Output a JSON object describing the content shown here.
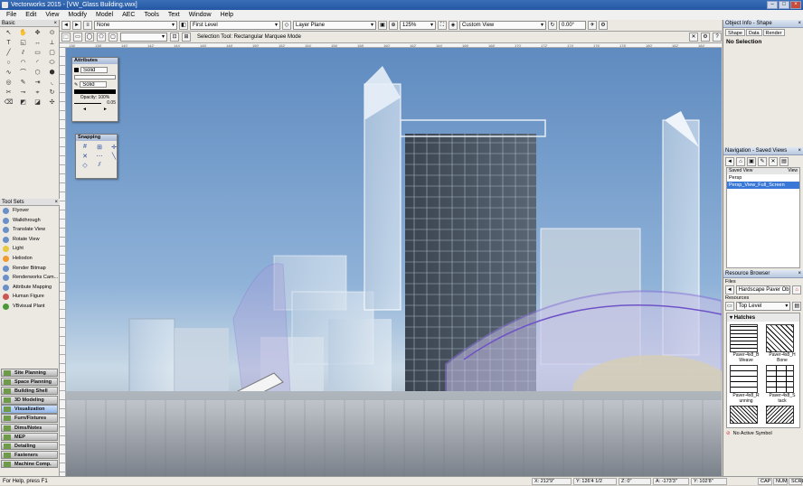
{
  "window": {
    "title": "Vectorworks 2015 - [VW_Glass Building.vwx]"
  },
  "menu": [
    "File",
    "Edit",
    "View",
    "Modify",
    "Model",
    "AEC",
    "Tools",
    "Text",
    "Window",
    "Help"
  ],
  "toolbar": {
    "class_value": "None",
    "layer_value": "First Level",
    "plane_value": "Layer Plane",
    "zoom_value": "125%",
    "view_value": "Custom View",
    "angle_value": "0.00°",
    "mode_text": "Selection Tool: Rectangular Marquee Mode"
  },
  "basic_palette": {
    "title": "Basic"
  },
  "attributes_palette": {
    "title": "Attributes",
    "fill_style": "Solid",
    "pen_style": "Solid",
    "opacity_label": "Opacity: 100%",
    "pen_weight": "0.05"
  },
  "snapping_palette": {
    "title": "Snapping"
  },
  "tool_sets": {
    "title": "Tool Sets",
    "items": [
      "Flyover",
      "Walkthrough",
      "Translate View",
      "Rotate View",
      "Light",
      "Heliodon",
      "Render Bitmap",
      "Renderworks Cam...",
      "Attribute Mapping",
      "Human Figure",
      "VBvisual Plant"
    ]
  },
  "categories": [
    "Site Planning",
    "Space Planning",
    "Building Shell",
    "3D Modeling",
    "Visualization",
    "Furn/Fixtures",
    "Dims/Notes",
    "MEP",
    "Detailing",
    "Fasteners",
    "Machine Comp."
  ],
  "active_category": "Visualization",
  "object_info": {
    "title": "Object Info - Shape",
    "tabs": [
      "Shape",
      "Data",
      "Render"
    ],
    "selection": "No Selection"
  },
  "navigation": {
    "title": "Navigation - Saved Views",
    "col_saved_view": "Saved View",
    "col_view": "View",
    "views": [
      "Persp",
      "Persp_View_Full_Screen"
    ],
    "selected_view": "Persp_View_Full_Screen"
  },
  "resource_browser": {
    "title": "Resource Browser",
    "files_label": "Files",
    "file_value": "Hardscape Paver Obj",
    "resources_label": "Resources",
    "folder_value": "Top Level",
    "section": "Hatches",
    "items": [
      "Paver-4x8_B Weave",
      "Paver-4x8_H Bone",
      "Paver-4x8_R unning",
      "Paver-4x8_S tack"
    ],
    "no_symbol": "No Active Symbol"
  },
  "status": {
    "help": "For Help, press F1",
    "x": "X: 212'9\"",
    "y": "Y: 126'4 1/2",
    "z": "Z: 0\"",
    "angle": "A: -173'3\"",
    "len": "Y: 102'8\"",
    "caps": "CAP",
    "num": "NUM",
    "scrl": "SCRL"
  },
  "ruler_marks": [
    "136'",
    "138'",
    "140'",
    "142'",
    "144'",
    "146'",
    "148'",
    "150'",
    "152'",
    "154'",
    "156'",
    "158'",
    "160'",
    "162'",
    "164'",
    "166'",
    "168'",
    "170'",
    "172'",
    "174'",
    "176'",
    "178'",
    "180'",
    "182'",
    "184'"
  ]
}
